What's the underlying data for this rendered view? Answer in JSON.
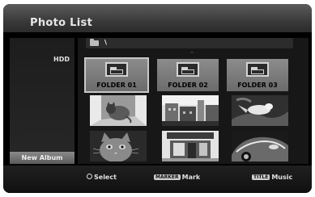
{
  "header": {
    "title": "Photo List"
  },
  "sidebar": {
    "source": "HDD",
    "new_album": "New Album"
  },
  "path": {
    "text": "\\"
  },
  "folders": [
    {
      "label": "FOLDER 01",
      "selected": true
    },
    {
      "label": "FOLDER 02",
      "selected": false
    },
    {
      "label": "FOLDER 03",
      "selected": false
    }
  ],
  "thumbnails": [
    {
      "name": "cat-on-floor"
    },
    {
      "name": "european-buildings"
    },
    {
      "name": "bird-on-leaves"
    },
    {
      "name": "kitten-closeup"
    },
    {
      "name": "storefront"
    },
    {
      "name": "vintage-car"
    }
  ],
  "footer": {
    "select_label": "Select",
    "marker_key": "MARKER",
    "mark_label": "Mark",
    "title_key": "TITLE",
    "music_label": "Music"
  },
  "colors": {
    "screen_bg": "#000000",
    "selection": "#c8c8c8"
  }
}
